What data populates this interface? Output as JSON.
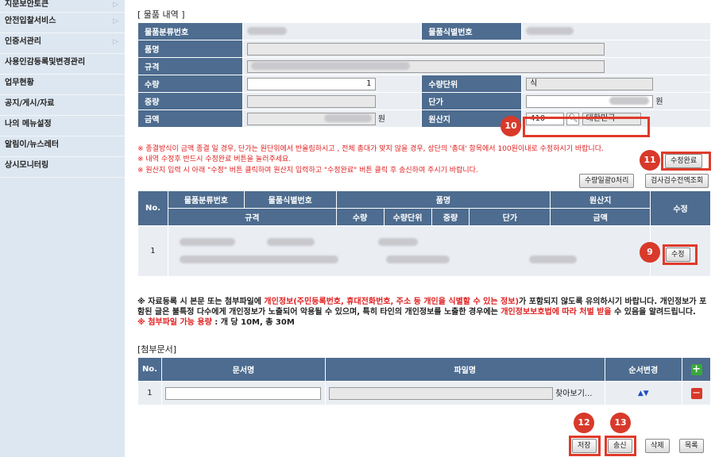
{
  "sidebar": {
    "items": [
      {
        "label": "지문보안토큰",
        "arrow": "▷"
      },
      {
        "label": "안전입찰서비스",
        "arrow": "▷"
      },
      {
        "label": "인증서관리",
        "arrow": "▷"
      },
      {
        "label": "사용인감등록및변경관리",
        "arrow": ""
      },
      {
        "label": "업무현황",
        "arrow": ""
      },
      {
        "label": "공지/게시/자료",
        "arrow": ""
      },
      {
        "label": "나의 메뉴설정",
        "arrow": ""
      },
      {
        "label": "알림이/뉴스레터",
        "arrow": ""
      },
      {
        "label": "상시모니터링",
        "arrow": ""
      }
    ]
  },
  "item_section": {
    "title": "[ 물품 내역 ]",
    "labels": {
      "class_no": "물품분류번호",
      "id_no": "물품식별번호",
      "name": "품명",
      "spec": "규격",
      "qty": "수량",
      "unit": "수량단위",
      "weight": "중량",
      "price": "단가",
      "amount": "금액",
      "origin": "원산지"
    },
    "values": {
      "qty": "1",
      "unit": "식",
      "won": "원",
      "origin_code": "410",
      "origin_name": "대한민국"
    }
  },
  "notices": [
    "※ 종결방식이 금액 종결 일 경우, 단가는 원단위에서 반올림하시고 , 전체 총대가 맞지 않을 경우, 상단의 '총대' 항목에서 100원이내로 수정하시기 바랍니다.",
    "※ 내역 수정후 반드시 수정완료 버튼을 눌러주세요.",
    "※ 원산지 입력 시 아래 \"수정\" 버튼 클릭하여 원산지 입력하고 \"수정완료\" 버튼 클릭 후 송신하여 주시기 바랍니다."
  ],
  "buttons": {
    "edit_done": "수정완료",
    "qty_zero": "수량일괄0처리",
    "inspect": "검사검수전액조회",
    "edit": "수정",
    "find": "찾아보기...",
    "save": "저장",
    "send": "송신",
    "delete": "삭제",
    "list": "목록"
  },
  "list_table": {
    "headers_top": [
      "No.",
      "물품분류번호",
      "물품식별번호",
      "품명",
      "원산지",
      "수정"
    ],
    "headers_bottom": [
      "규격",
      "수량",
      "수량단위",
      "중량",
      "단가",
      "금액"
    ],
    "rows": [
      {
        "no": "1"
      }
    ]
  },
  "privacy": {
    "p1": "※ 자료등록 시 본문 또는 첨부파일에 ",
    "p2": "개인정보(주민등록번호, 휴대전화번호, 주소 등 개인을 식별할 수 있는 정보)",
    "p3": "가 포함되지 않도록 유의하시기 바랍니다. 개인정보가 포함된 글은 불특정 다수에게 개인정보가 노출되어 악용될 수 있으며, 특히 타인의 개인정보를 노출한 경우에는 ",
    "p4": "개인정보보호법에 따라 처벌 받을",
    "p5": " 수 있음을 알려드립니다.",
    "cap_label": "※ 첨부파일 가능 용량",
    "cap_value": " : 개 당 10M, 총 30M"
  },
  "attach": {
    "title": "[첨부문서]",
    "headers": [
      "No.",
      "문서명",
      "파일명",
      "순서변경"
    ],
    "rows": [
      {
        "no": "1",
        "order": "▲▼"
      }
    ]
  },
  "badges": {
    "b9": "9",
    "b10": "10",
    "b11": "11",
    "b12": "12",
    "b13": "13"
  },
  "colors": {
    "header": "#4d6c8f",
    "highlight": "#e03a2a",
    "notice": "#e02020"
  }
}
